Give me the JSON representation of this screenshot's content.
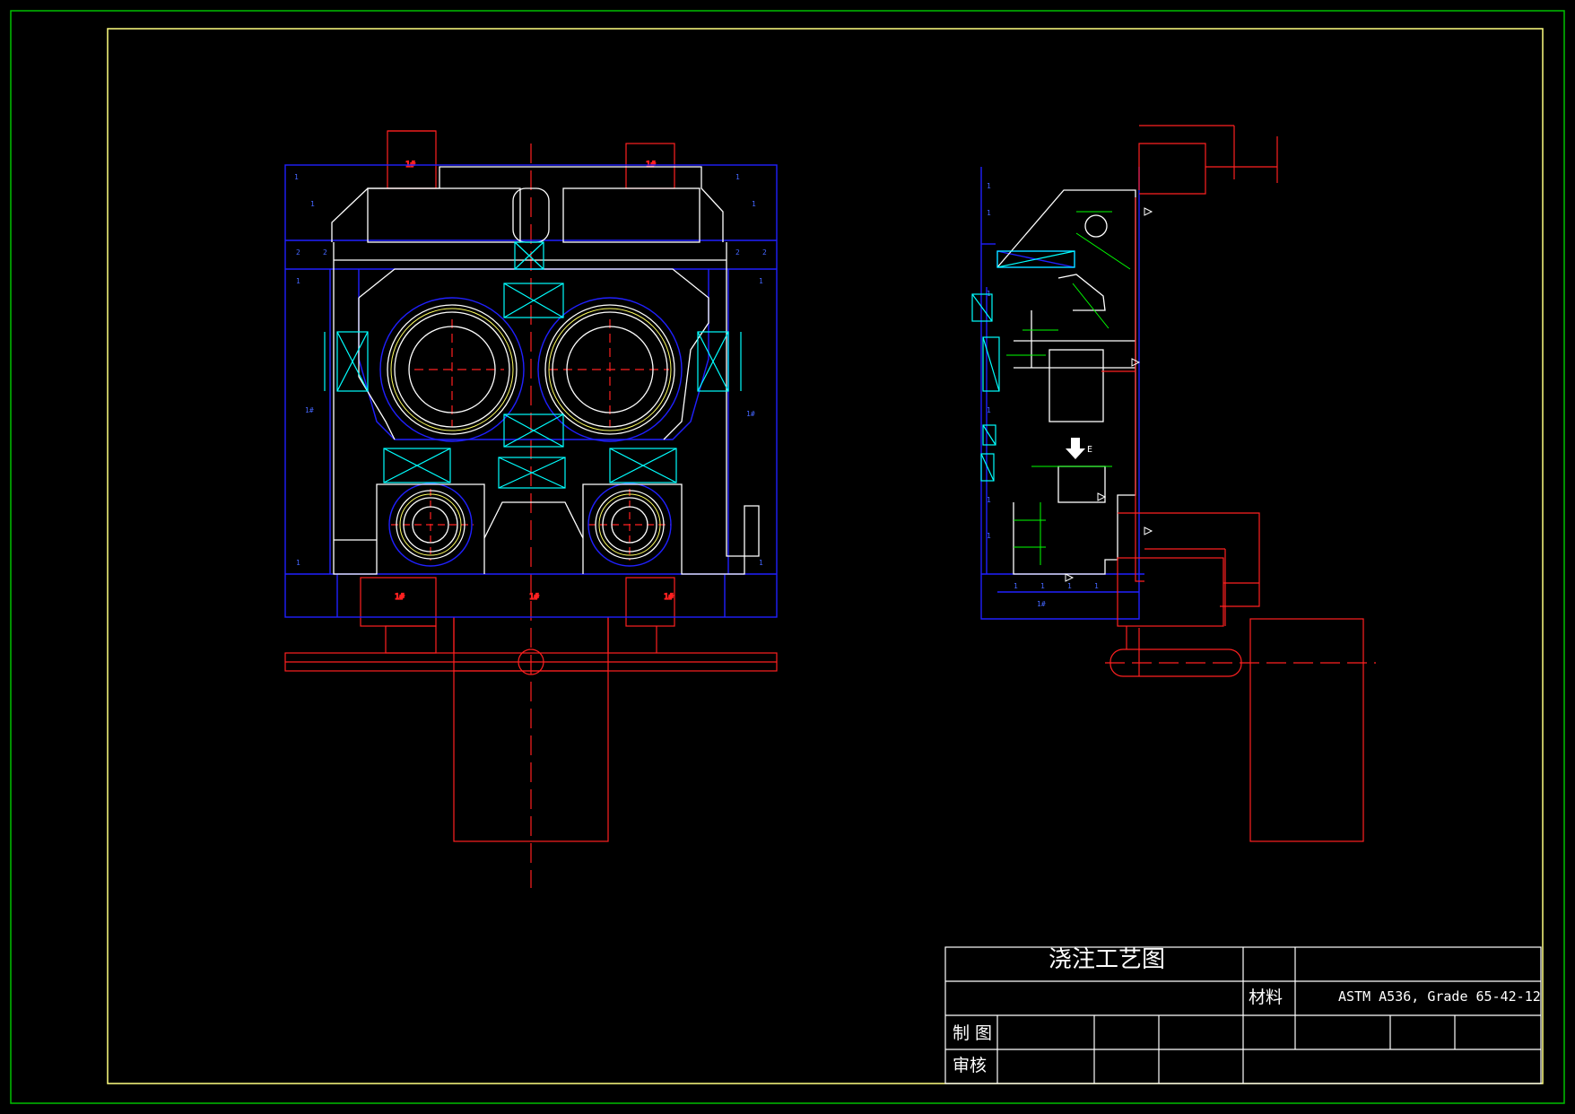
{
  "title_block": {
    "title": "浇注工艺图",
    "material_label": "材料",
    "material_value": "ASTM A536, Grade 65-42-12",
    "drawn_label": "制  图",
    "check_label": "审核"
  },
  "annotations": {
    "front_marks": [
      "1#",
      "1#",
      "1#",
      "1#",
      "1#",
      "1#",
      "4#"
    ],
    "side_marks": [
      "1#",
      "1#"
    ],
    "arrow_label": "E"
  },
  "colors": {
    "background": "#000000",
    "outer_border": "#00c000",
    "inner_border": "#ffff80",
    "casting": "#ffffff",
    "mold": "#2020ff",
    "core": "#00ffff",
    "gating": "#ff2020",
    "dimension": "#00ff00"
  }
}
